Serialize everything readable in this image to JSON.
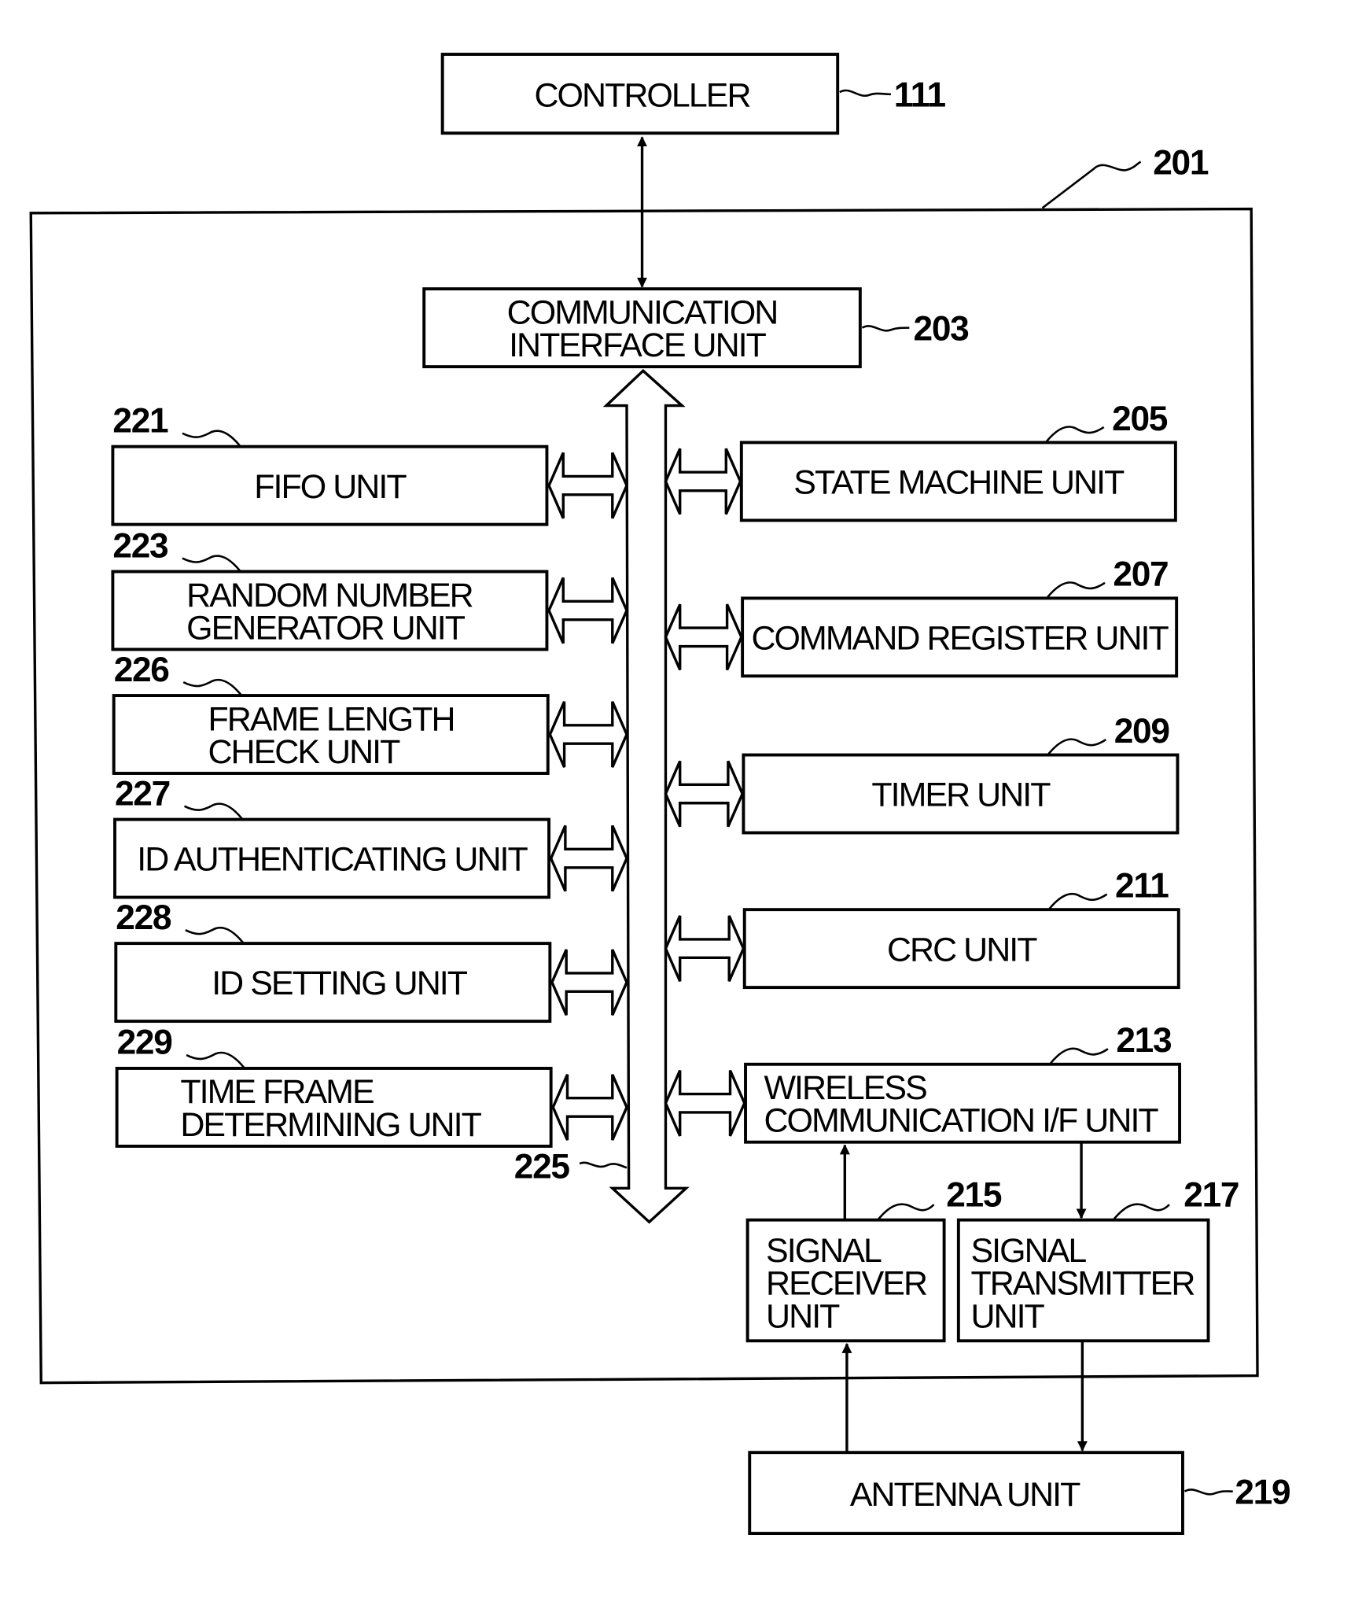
{
  "diagram": {
    "controller": {
      "ref": "111",
      "lines": [
        "CONTROLLER"
      ]
    },
    "device": {
      "ref": "201"
    },
    "comm_if": {
      "ref": "203",
      "lines": [
        "COMMUNICATION",
        "INTERFACE UNIT"
      ]
    },
    "bus": {
      "ref": "225"
    },
    "left_units": [
      {
        "ref": "221",
        "lines": [
          "FIFO UNIT"
        ]
      },
      {
        "ref": "223",
        "lines": [
          "RANDOM NUMBER",
          "GENERATOR UNIT"
        ]
      },
      {
        "ref": "226",
        "lines": [
          "FRAME LENGTH",
          "CHECK UNIT"
        ]
      },
      {
        "ref": "227",
        "lines": [
          "ID AUTHENTICATING UNIT"
        ]
      },
      {
        "ref": "228",
        "lines": [
          "ID SETTING UNIT"
        ]
      },
      {
        "ref": "229",
        "lines": [
          "TIME FRAME",
          "DETERMINING UNIT"
        ]
      }
    ],
    "right_units": [
      {
        "ref": "205",
        "lines": [
          "STATE MACHINE UNIT"
        ]
      },
      {
        "ref": "207",
        "lines": [
          "COMMAND REGISTER UNIT"
        ]
      },
      {
        "ref": "209",
        "lines": [
          "TIMER UNIT"
        ]
      },
      {
        "ref": "211",
        "lines": [
          "CRC UNIT"
        ]
      },
      {
        "ref": "213",
        "lines": [
          "WIRELESS",
          "COMMUNICATION I/F UNIT"
        ]
      }
    ],
    "signal_receiver": {
      "ref": "215",
      "lines": [
        "SIGNAL",
        "RECEIVER",
        "UNIT"
      ]
    },
    "signal_transmitter": {
      "ref": "217",
      "lines": [
        "SIGNAL",
        "TRANSMITTER",
        "UNIT"
      ]
    },
    "antenna": {
      "ref": "219",
      "lines": [
        "ANTENNA UNIT"
      ]
    }
  }
}
